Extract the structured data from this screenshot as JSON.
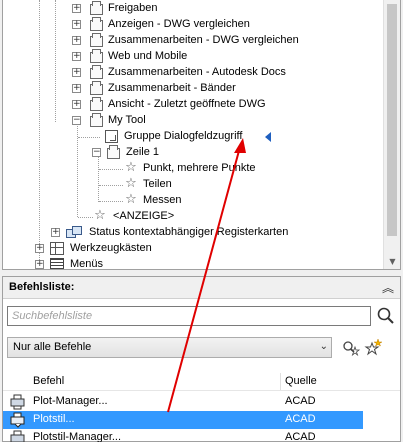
{
  "tree": {
    "items": [
      {
        "label": "Freigaben"
      },
      {
        "label": "Anzeigen - DWG vergleichen"
      },
      {
        "label": "Zusammenarbeiten - DWG vergleichen"
      },
      {
        "label": "Web und Mobile"
      },
      {
        "label": "Zusammenarbeiten - Autodesk Docs"
      },
      {
        "label": "Zusammenarbeit - Bänder"
      },
      {
        "label": "Ansicht - Zuletzt geöffnete DWG"
      },
      {
        "label": "My Tool"
      },
      {
        "label": "Gruppe Dialogfeldzugriff"
      },
      {
        "label": "Zeile 1"
      },
      {
        "label": "Punkt, mehrere Punkte"
      },
      {
        "label": "Teilen"
      },
      {
        "label": "Messen"
      },
      {
        "label": "<ANZEIGE>"
      },
      {
        "label": "Status kontextabhängiger Registerkarten"
      },
      {
        "label": "Werkzeugkästen"
      },
      {
        "label": "Menüs"
      }
    ]
  },
  "command_list": {
    "title": "Befehlsliste:",
    "search_placeholder": "Suchbefehlsliste",
    "filter_value": "Nur alle Befehle",
    "columns": [
      "Befehl",
      "Quelle"
    ],
    "rows": [
      {
        "name": "Plot-Manager...",
        "source": "ACAD"
      },
      {
        "name": "Plotstil...",
        "source": "ACAD"
      },
      {
        "name": "Plotstil-Manager...",
        "source": "ACAD"
      }
    ]
  },
  "colors": {
    "selection": "#3399ff",
    "annotation_arrow": "#e00000",
    "marker": "#1f5fbf"
  }
}
